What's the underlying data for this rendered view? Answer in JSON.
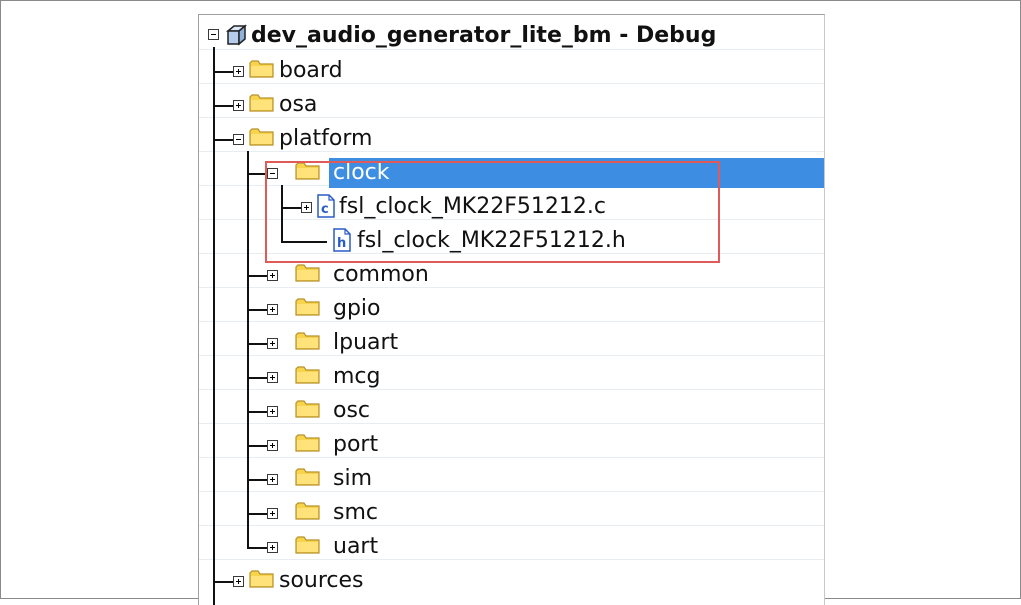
{
  "tree": {
    "root": {
      "label": "dev_audio_generator_lite_bm",
      "suffix": " - Debug",
      "icon": "project-cube-icon",
      "state": "expanded"
    },
    "nodes": [
      {
        "label": "board",
        "icon": "folder-icon",
        "state": "collapsed"
      },
      {
        "label": "osa",
        "icon": "folder-icon",
        "state": "collapsed"
      },
      {
        "label": "platform",
        "icon": "folder-icon",
        "state": "expanded"
      },
      {
        "label": "clock",
        "icon": "folder-icon",
        "state": "expanded",
        "selected": true
      },
      {
        "label": "fsl_clock_MK22F51212.c",
        "icon": "c-file-icon",
        "state": "collapsed"
      },
      {
        "label": "fsl_clock_MK22F51212.h",
        "icon": "h-file-icon",
        "state": "leaf"
      },
      {
        "label": "common",
        "icon": "folder-icon",
        "state": "collapsed"
      },
      {
        "label": "gpio",
        "icon": "folder-icon",
        "state": "collapsed"
      },
      {
        "label": "lpuart",
        "icon": "folder-icon",
        "state": "collapsed"
      },
      {
        "label": "mcg",
        "icon": "folder-icon",
        "state": "collapsed"
      },
      {
        "label": "osc",
        "icon": "folder-icon",
        "state": "collapsed"
      },
      {
        "label": "port",
        "icon": "folder-icon",
        "state": "collapsed"
      },
      {
        "label": "sim",
        "icon": "folder-icon",
        "state": "collapsed"
      },
      {
        "label": "smc",
        "icon": "folder-icon",
        "state": "collapsed"
      },
      {
        "label": "uart",
        "icon": "folder-icon",
        "state": "collapsed"
      },
      {
        "label": "sources",
        "icon": "folder-icon",
        "state": "collapsed"
      }
    ]
  },
  "colors": {
    "selection": "#3d8ee3",
    "highlight_border": "#e05a5a",
    "folder_fill": "#f7d44c",
    "folder_outline": "#b8912a",
    "file_icon_blue": "#2a5cc8"
  }
}
